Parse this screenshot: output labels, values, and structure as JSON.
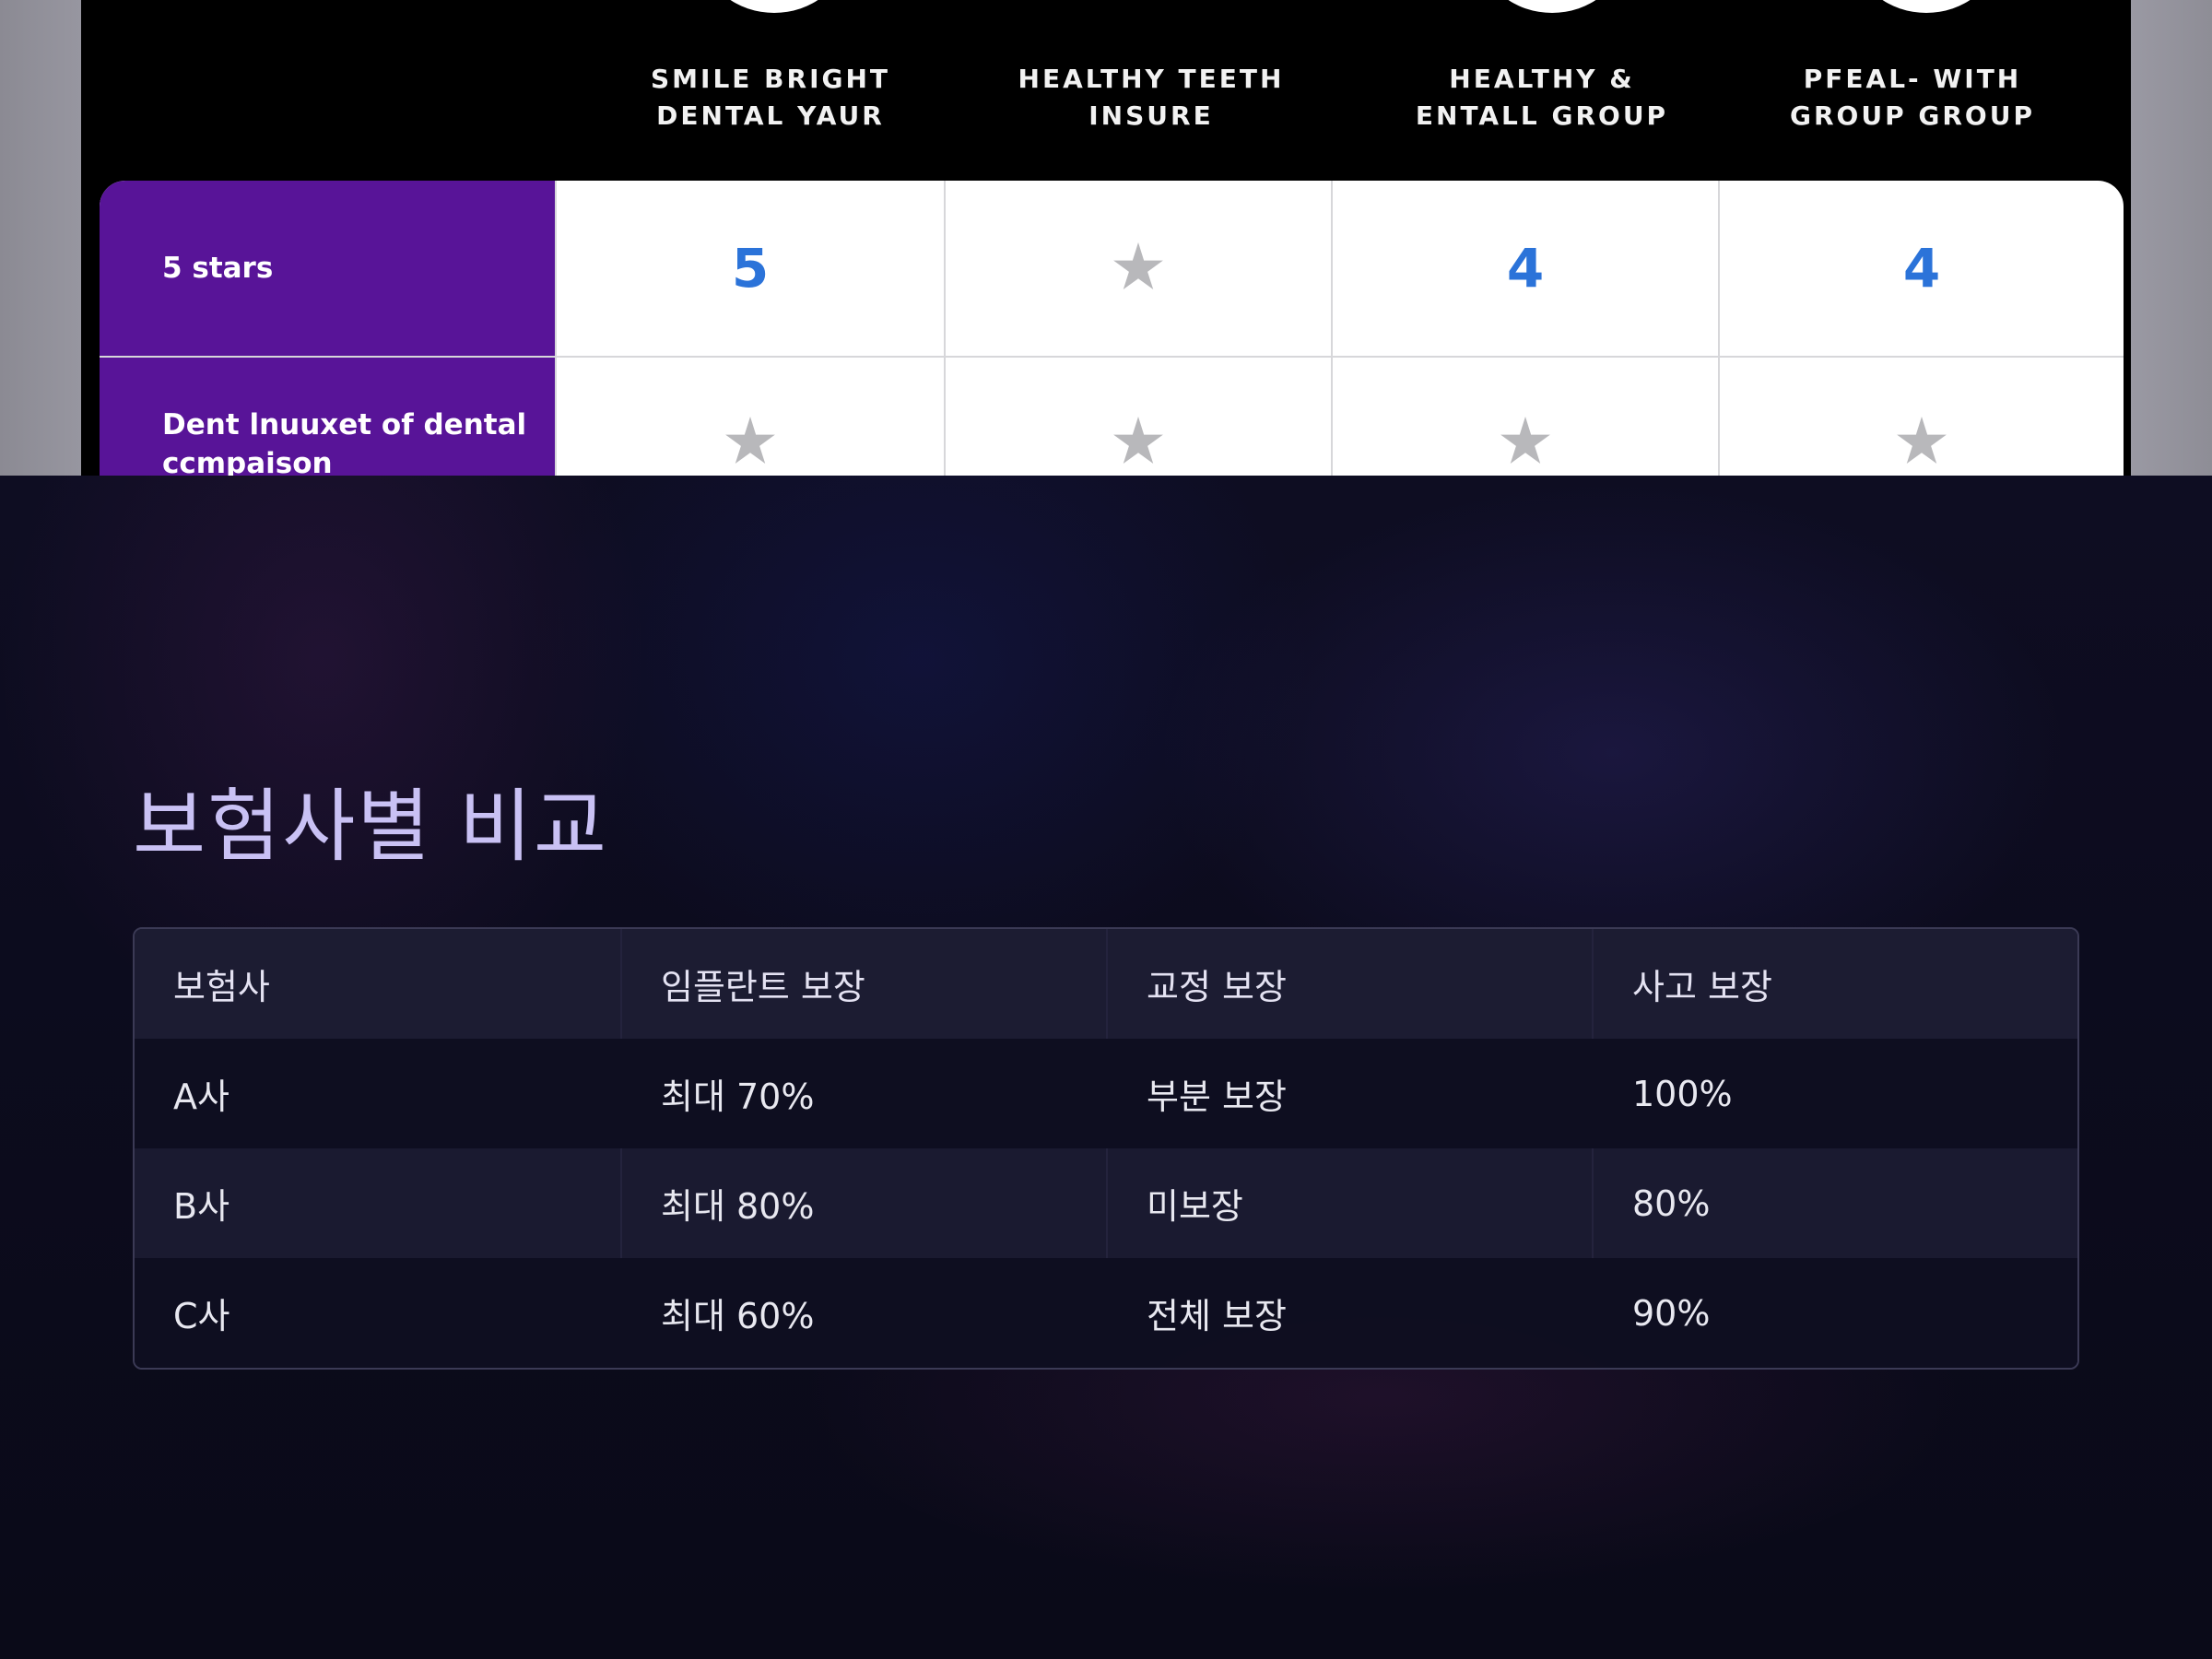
{
  "top_image": {
    "companies": [
      "SMILE BRIGHT\nDENTAL YAUR",
      "HEALTHY TEETH\nINSURE",
      "HEALTHY &\nENTALL GROUP",
      "PFEAL- WITH\nGROUP GROUP"
    ],
    "rows": [
      {
        "label": "5 stars",
        "cells": [
          "5",
          "star",
          "4",
          "4"
        ]
      },
      {
        "label": "Dent lnuuxet of dental\nccmpaison",
        "cells": [
          "star",
          "star",
          "star",
          "star"
        ]
      }
    ],
    "colors": {
      "label_bg": "#581498",
      "number": "#2b73d9",
      "star": "#b8b8bb"
    }
  },
  "slide": {
    "title": "보험사별 비교",
    "table": {
      "headers": [
        "보험사",
        "임플란트 보장",
        "교정 보장",
        "사고 보장"
      ],
      "rows": [
        [
          "A사",
          "최대 70%",
          "부분 보장",
          "100%"
        ],
        [
          "B사",
          "최대 80%",
          "미보장",
          "80%"
        ],
        [
          "C사",
          "최대 60%",
          "전체 보장",
          "90%"
        ]
      ]
    },
    "colors": {
      "title": "#c9c1f4",
      "background": "#0b0b1a"
    }
  }
}
